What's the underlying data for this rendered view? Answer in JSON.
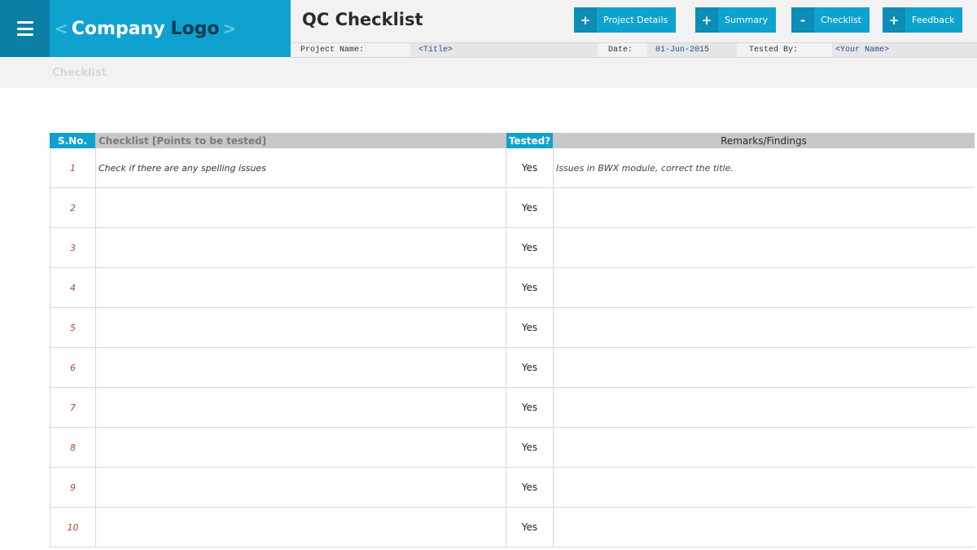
{
  "header": {
    "logo_left_chevron": "<",
    "logo_word1": "Company",
    "logo_word2": "Logo",
    "logo_right_chevron": ">",
    "app_title": "QC Checklist",
    "buttons": [
      {
        "symbol": "+",
        "label": "Project Details"
      },
      {
        "symbol": "+",
        "label": "Summary"
      },
      {
        "symbol": "-",
        "label": "Checklist"
      },
      {
        "symbol": "+",
        "label": "Feedback"
      }
    ]
  },
  "info": {
    "project_name_label": "Project Name:",
    "project_name_value": "<Title>",
    "date_label": "Date:",
    "date_value": "01-Jun-2015",
    "tested_by_label": "Tested By:",
    "tested_by_value": "<Your Name>"
  },
  "section_title": "Checklist",
  "table": {
    "headers": {
      "sno": "S.No.",
      "checklist": "Checklist [Points to be tested]",
      "tested": "Tested?",
      "remarks": "Remarks/Findings"
    },
    "rows": [
      {
        "sno": "1",
        "checklist": "Check if there are any spelling issues",
        "tested": "Yes",
        "remarks": "Issues in BWX module, correct the title."
      },
      {
        "sno": "2",
        "checklist": "",
        "tested": "Yes",
        "remarks": ""
      },
      {
        "sno": "3",
        "checklist": "",
        "tested": "Yes",
        "remarks": ""
      },
      {
        "sno": "4",
        "checklist": "",
        "tested": "Yes",
        "remarks": ""
      },
      {
        "sno": "5",
        "checklist": "",
        "tested": "Yes",
        "remarks": ""
      },
      {
        "sno": "6",
        "checklist": "",
        "tested": "Yes",
        "remarks": ""
      },
      {
        "sno": "7",
        "checklist": "",
        "tested": "Yes",
        "remarks": ""
      },
      {
        "sno": "8",
        "checklist": "",
        "tested": "Yes",
        "remarks": ""
      },
      {
        "sno": "9",
        "checklist": "",
        "tested": "Yes",
        "remarks": ""
      },
      {
        "sno": "10",
        "checklist": "",
        "tested": "Yes",
        "remarks": ""
      }
    ]
  }
}
